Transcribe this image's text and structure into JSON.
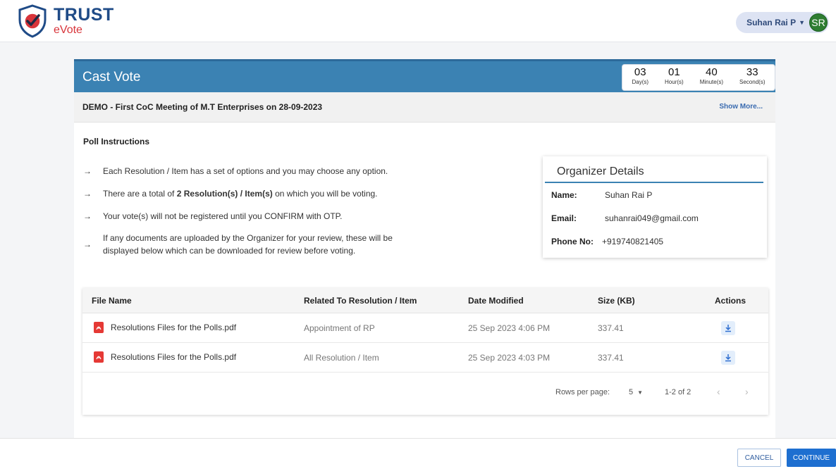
{
  "brand": {
    "title": "TRUST",
    "subtitle": "eVote"
  },
  "user": {
    "name": "Suhan Rai P",
    "initials": "SR"
  },
  "cast_vote": {
    "title": "Cast Vote",
    "countdown": [
      {
        "value": "03",
        "label": "Day(s)"
      },
      {
        "value": "01",
        "label": "Hour(s)"
      },
      {
        "value": "40",
        "label": "Minute(s)"
      },
      {
        "value": "33",
        "label": "Second(s)"
      }
    ]
  },
  "meeting": {
    "title": "DEMO - First CoC Meeting of M.T Enterprises on 28-09-2023",
    "show_more": "Show More..."
  },
  "poll_instructions": {
    "heading": "Poll Instructions",
    "items": [
      {
        "text": "Each Resolution / Item has a set of options and you may choose any option."
      },
      {
        "prefix": "There are a total of ",
        "bold": "2 Resolution(s) / Item(s)",
        "suffix": " on which you will be voting."
      },
      {
        "text": "Your vote(s) will not be registered until you CONFIRM with OTP."
      },
      {
        "line1": "If any documents are uploaded by the Organizer for your review, these will be",
        "line2": "displayed below which can be downloaded for review before voting."
      }
    ]
  },
  "organizer": {
    "title": "Organizer Details",
    "name_label": "Name:",
    "name": "Suhan Rai P",
    "email_label": "Email:",
    "email": "suhanrai049@gmail.com",
    "phone_label": "Phone No:",
    "phone": "+919740821405"
  },
  "files_table": {
    "columns": [
      "File Name",
      "Related To Resolution / Item",
      "Date Modified",
      "Size (KB)",
      "Actions"
    ],
    "rows": [
      {
        "file_name": "Resolutions Files for the Polls.pdf",
        "related": "Appointment of RP",
        "date": "25 Sep 2023  4:06 PM",
        "size": "337.41"
      },
      {
        "file_name": "Resolutions Files for the Polls.pdf",
        "related": "All Resolution / Item",
        "date": "25 Sep 2023  4:03 PM",
        "size": "337.41"
      }
    ],
    "pagination": {
      "rows_per_page_label": "Rows per page:",
      "rows_per_page": "5",
      "range": "1-2 of 2",
      "prev": "‹",
      "next": "›"
    }
  },
  "actions": {
    "cancel": "CANCEL",
    "continue": "CONTINUE"
  },
  "colors": {
    "header_blue": "#3b82b3",
    "brand_navy": "#1f4b87",
    "brand_red": "#d8343a",
    "avatar_green": "#2e7d32",
    "primary_button": "#1e6fd0"
  },
  "icons": {
    "logo": "shield-check-logo",
    "file": "pdf-file-icon",
    "download": "download-icon",
    "caret": "chevron-down-icon"
  }
}
